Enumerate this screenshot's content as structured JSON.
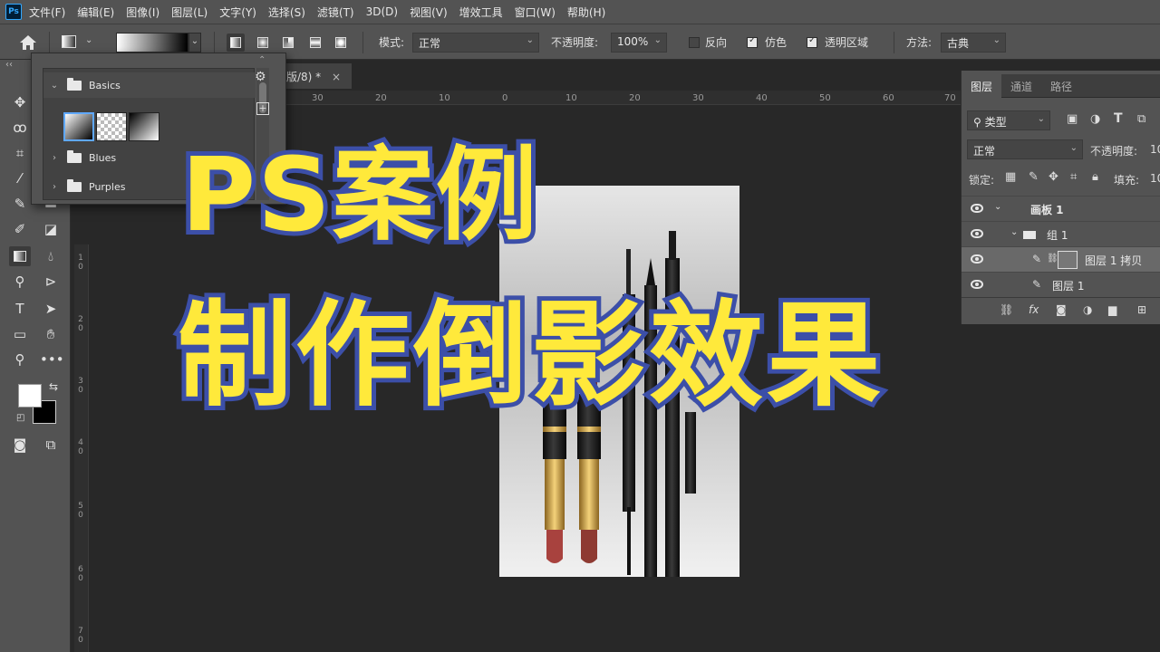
{
  "app": {
    "logo_text": "Ps"
  },
  "menu": [
    "文件(F)",
    "编辑(E)",
    "图像(I)",
    "图层(L)",
    "文字(Y)",
    "选择(S)",
    "滤镜(T)",
    "3D(D)",
    "视图(V)",
    "增效工具",
    "窗口(W)",
    "帮助(H)"
  ],
  "options": {
    "mode_label": "模式:",
    "mode_value": "正常",
    "opacity_label": "不透明度:",
    "opacity_value": "100%",
    "reverse_label": "反向",
    "dither_label": "仿色",
    "transparency_label": "透明区域",
    "method_label": "方法:",
    "method_value": "古典",
    "reverse_checked": false,
    "dither_checked": true,
    "transparency_checked": true
  },
  "gradient_picker": {
    "folders": [
      {
        "name": "Basics",
        "expanded": true
      },
      {
        "name": "Blues",
        "expanded": false
      },
      {
        "name": "Purples",
        "expanded": false
      }
    ]
  },
  "document": {
    "tab_label": "版/8) *",
    "close_glyph": "×"
  },
  "ruler": {
    "h_ticks": [
      "30",
      "20",
      "10",
      "0",
      "10",
      "20",
      "30",
      "40",
      "50",
      "60",
      "70"
    ],
    "v_ticks": [
      "1\n0",
      "2\n0",
      "3\n0",
      "4\n0",
      "5\n0",
      "6\n0",
      "7\n0"
    ]
  },
  "layers_panel": {
    "tabs": [
      "图层",
      "通道",
      "路径"
    ],
    "filter_label": "类型",
    "blend_mode": "正常",
    "opacity_label": "不透明度:",
    "opacity_value": "10",
    "lock_label": "锁定:",
    "fill_label": "填充:",
    "fill_value": "10",
    "layers": [
      {
        "name": "画板 1"
      },
      {
        "name": "组 1"
      },
      {
        "name": "图层 1 拷贝"
      },
      {
        "name": "图层 1"
      }
    ]
  },
  "overlay": {
    "title_line1": "PS案例",
    "title_line2": "制作倒影效果"
  },
  "colors": {
    "title_fill": "#ffe93b",
    "title_stroke": "#3c4fa8",
    "ui_bg": "#535353",
    "canvas_bg": "#282828"
  }
}
